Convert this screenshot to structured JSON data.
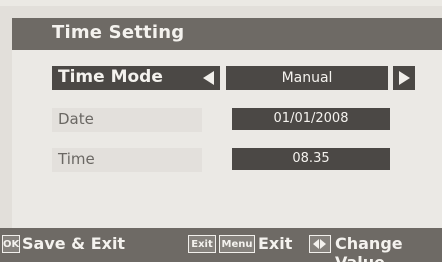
{
  "title": "Time Setting",
  "rows": {
    "time_mode": {
      "label": "Time Mode",
      "value": "Manual"
    },
    "date": {
      "label": "Date",
      "value": "01/01/2008"
    },
    "time": {
      "label": "Time",
      "value": "08.35"
    }
  },
  "footer": {
    "ok_key": "OK",
    "save_exit": "Save & Exit",
    "exit_key": "Exit",
    "menu_key": "Menu",
    "exit": "Exit",
    "change_value": "Change Value"
  },
  "icons": {
    "left_arrow": "left-arrow-icon",
    "right_arrow": "right-arrow-icon",
    "left_right": "left-right-icon"
  }
}
